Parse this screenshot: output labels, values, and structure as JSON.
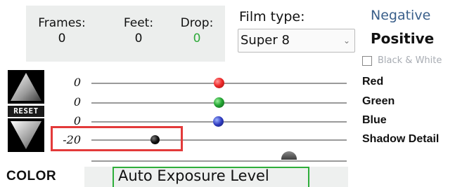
{
  "counters": {
    "frames": {
      "label": "Frames:",
      "value": "0"
    },
    "feet": {
      "label": "Feet:",
      "value": "0"
    },
    "drop": {
      "label": "Drop:",
      "value": "0"
    }
  },
  "film_type": {
    "label": "Film type:",
    "selected": "Super 8"
  },
  "film_mode": {
    "negative": "Negative",
    "positive": "Positive",
    "black_white": "Black & White",
    "black_white_checked": false
  },
  "buttons": {
    "reset": "RESET"
  },
  "sliders": [
    {
      "name": "Red",
      "value": "0",
      "color": "#e82a2a"
    },
    {
      "name": "Green",
      "value": "0",
      "color": "#22a431"
    },
    {
      "name": "Blue",
      "value": "0",
      "color": "#2b36b8"
    },
    {
      "name": "Shadow Detail",
      "value": "-20",
      "color": "#111111"
    }
  ],
  "auto_exposure": "Auto Exposure Level",
  "section_title": "COLOR"
}
